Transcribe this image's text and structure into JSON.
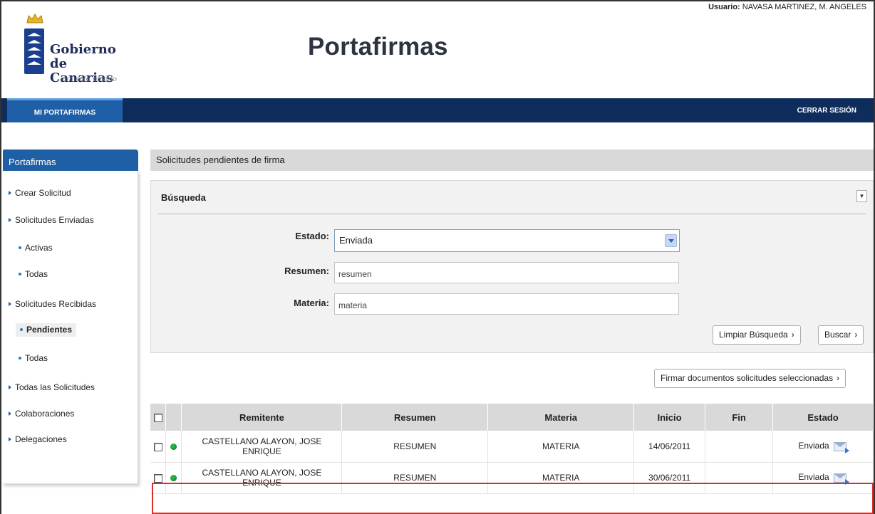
{
  "header": {
    "logo_line1": "Gobierno",
    "logo_line2": "de Canarias",
    "logo_tagline": "un solo pueblo",
    "app_title": "Portafirmas",
    "user_label": "Usuario:",
    "user_name": "NAVASA MARTINEZ, M. ANGELES"
  },
  "navbar": {
    "tab_label": "MI PORTAFIRMAS",
    "logout_label": "CERRAR SESIÓN"
  },
  "sidebar": {
    "title": "Portafirmas",
    "items": [
      {
        "label": "Crear Solicitud"
      },
      {
        "label": "Solicitudes Enviadas"
      },
      {
        "label": "Activas"
      },
      {
        "label": "Todas"
      },
      {
        "label": "Solicitudes Recibidas"
      },
      {
        "label": "Pendientes"
      },
      {
        "label": "Todas"
      },
      {
        "label": "Todas las Solicitudes"
      },
      {
        "label": "Colaboraciones"
      },
      {
        "label": "Delegaciones"
      }
    ]
  },
  "main": {
    "title": "Solicitudes pendientes de firma",
    "search": {
      "title": "Búsqueda",
      "estado_label": "Estado:",
      "estado_value": "Enviada",
      "resumen_label": "Resumen:",
      "resumen_value": "resumen",
      "materia_label": "Materia:",
      "materia_value": "materia",
      "clear_label": "Limpiar Búsqueda",
      "search_label": "Buscar"
    },
    "sign_selected_label": "Firmar documentos solicitudes seleccionadas",
    "table": {
      "columns": [
        "Remitente",
        "Resumen",
        "Materia",
        "Inicio",
        "Fin",
        "Estado"
      ],
      "rows": [
        {
          "remitente": "CASTELLANO ALAYON, JOSE ENRIQUE",
          "resumen": "RESUMEN",
          "materia": "MATERIA",
          "inicio": "14/06/2011",
          "fin": "",
          "estado": "Enviada"
        },
        {
          "remitente": "CASTELLANO ALAYON, JOSE ENRIQUE",
          "resumen": "RESUMEN",
          "materia": "MATERIA",
          "inicio": "30/06/2011",
          "fin": "",
          "estado": "Enviada"
        }
      ]
    }
  },
  "colors": {
    "navbar": "#0f2d5c",
    "accent": "#1f5fa5",
    "status_green": "#27b24a",
    "highlight_red": "#d9302b"
  }
}
